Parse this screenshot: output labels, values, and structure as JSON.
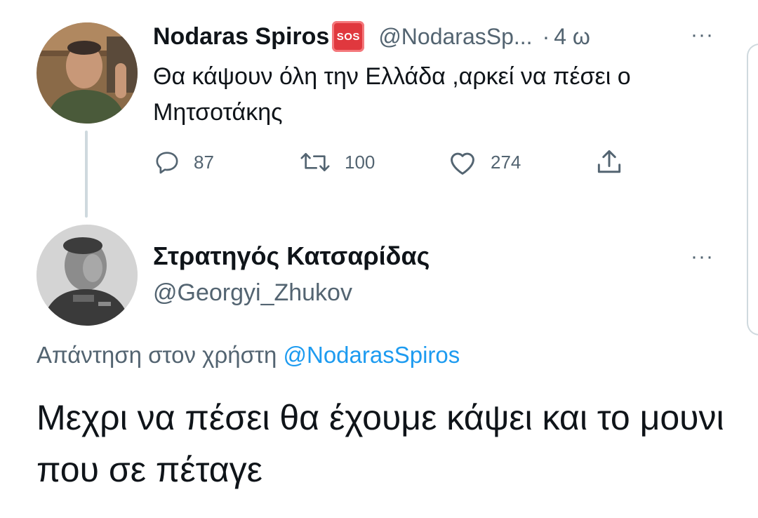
{
  "tweet_original": {
    "author_name": "Nodaras Spiros",
    "badge": "SOS",
    "handle": "@NodarasSp...",
    "separator": "·",
    "time": "4 ω",
    "more": "···",
    "text": "Θα κάψουν όλη την Ελλάδα ,αρκεί να πέσει ο Μητσοτάκης",
    "actions": {
      "replies": "87",
      "retweets": "100",
      "likes": "274"
    }
  },
  "tweet_reply": {
    "author_name": "Στρατηγός Κατσαρίδας",
    "handle": "@Georgyi_Zhukov",
    "more": "···",
    "replying_to_label": "Απάντηση στον χρήστη",
    "replying_to_handle": "@NodarasSpiros",
    "text": "Μεχρι να πέσει θα έχουμε κάψει και το μουνι που σε πέταγε"
  },
  "colors": {
    "text": "#0f1419",
    "muted": "#536471",
    "link": "#1d9bf0",
    "sos": "#e0383e",
    "thread_line": "#cfd9de"
  },
  "icons": [
    "reply-icon",
    "retweet-icon",
    "like-icon",
    "share-icon",
    "more-icon",
    "sos-emoji"
  ]
}
